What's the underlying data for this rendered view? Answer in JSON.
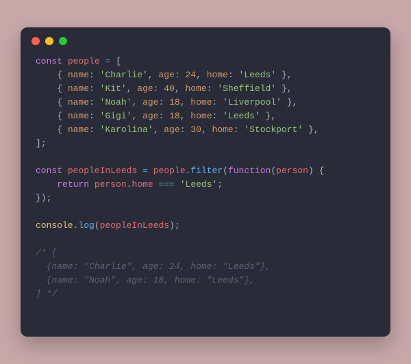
{
  "colors": {
    "pageBg": "#c8a7a8",
    "windowBg": "#292c38",
    "text": "#abb2bf",
    "keyword": "#c678dd",
    "identifier": "#e06c75",
    "function": "#61afef",
    "punctuation": "#abb2bf",
    "property": "#d19a66",
    "string": "#98c379",
    "number": "#d19a66",
    "operator": "#56b6c2",
    "builtin": "#e5c07b",
    "comment": "#5c6370",
    "dotRed": "#ff5f56",
    "dotYellow": "#ffbd2e",
    "dotGreen": "#27c93f"
  },
  "lines": [
    {
      "i": 0,
      "tokens": [
        {
          "t": "const",
          "c": "kw"
        },
        {
          "t": " "
        },
        {
          "t": "people",
          "c": "id"
        },
        {
          "t": " "
        },
        {
          "t": "=",
          "c": "op"
        },
        {
          "t": " ["
        }
      ]
    },
    {
      "i": 1,
      "tokens": [
        {
          "t": "    { "
        },
        {
          "t": "name",
          "c": "pr"
        },
        {
          "t": ": "
        },
        {
          "t": "'Charlie'",
          "c": "st"
        },
        {
          "t": ", "
        },
        {
          "t": "age",
          "c": "pr"
        },
        {
          "t": ": "
        },
        {
          "t": "24",
          "c": "nm"
        },
        {
          "t": ", "
        },
        {
          "t": "home",
          "c": "pr"
        },
        {
          "t": ": "
        },
        {
          "t": "'Leeds'",
          "c": "st"
        },
        {
          "t": " },"
        }
      ]
    },
    {
      "i": 2,
      "tokens": [
        {
          "t": "    { "
        },
        {
          "t": "name",
          "c": "pr"
        },
        {
          "t": ": "
        },
        {
          "t": "'Kit'",
          "c": "st"
        },
        {
          "t": ", "
        },
        {
          "t": "age",
          "c": "pr"
        },
        {
          "t": ": "
        },
        {
          "t": "40",
          "c": "nm"
        },
        {
          "t": ", "
        },
        {
          "t": "home",
          "c": "pr"
        },
        {
          "t": ": "
        },
        {
          "t": "'Sheffield'",
          "c": "st"
        },
        {
          "t": " },"
        }
      ]
    },
    {
      "i": 3,
      "tokens": [
        {
          "t": "    { "
        },
        {
          "t": "name",
          "c": "pr"
        },
        {
          "t": ": "
        },
        {
          "t": "'Noah'",
          "c": "st"
        },
        {
          "t": ", "
        },
        {
          "t": "age",
          "c": "pr"
        },
        {
          "t": ": "
        },
        {
          "t": "18",
          "c": "nm"
        },
        {
          "t": ", "
        },
        {
          "t": "home",
          "c": "pr"
        },
        {
          "t": ": "
        },
        {
          "t": "'Liverpool'",
          "c": "st"
        },
        {
          "t": " },"
        }
      ]
    },
    {
      "i": 4,
      "tokens": [
        {
          "t": "    { "
        },
        {
          "t": "name",
          "c": "pr"
        },
        {
          "t": ": "
        },
        {
          "t": "'Gigi'",
          "c": "st"
        },
        {
          "t": ", "
        },
        {
          "t": "age",
          "c": "pr"
        },
        {
          "t": ": "
        },
        {
          "t": "18",
          "c": "nm"
        },
        {
          "t": ", "
        },
        {
          "t": "home",
          "c": "pr"
        },
        {
          "t": ": "
        },
        {
          "t": "'Leeds'",
          "c": "st"
        },
        {
          "t": " },"
        }
      ]
    },
    {
      "i": 5,
      "tokens": [
        {
          "t": "    { "
        },
        {
          "t": "name",
          "c": "pr"
        },
        {
          "t": ": "
        },
        {
          "t": "'Karolina'",
          "c": "st"
        },
        {
          "t": ", "
        },
        {
          "t": "age",
          "c": "pr"
        },
        {
          "t": ": "
        },
        {
          "t": "30",
          "c": "nm"
        },
        {
          "t": ", "
        },
        {
          "t": "home",
          "c": "pr"
        },
        {
          "t": ": "
        },
        {
          "t": "'Stockport'",
          "c": "st"
        },
        {
          "t": " },"
        }
      ]
    },
    {
      "i": 6,
      "tokens": [
        {
          "t": "];"
        }
      ]
    },
    {
      "i": 7,
      "tokens": [
        {
          "t": ""
        }
      ]
    },
    {
      "i": 8,
      "tokens": [
        {
          "t": "const",
          "c": "kw"
        },
        {
          "t": " "
        },
        {
          "t": "peopleInLeeds",
          "c": "id"
        },
        {
          "t": " "
        },
        {
          "t": "=",
          "c": "op"
        },
        {
          "t": " "
        },
        {
          "t": "people",
          "c": "id"
        },
        {
          "t": "."
        },
        {
          "t": "filter",
          "c": "fn"
        },
        {
          "t": "("
        },
        {
          "t": "function",
          "c": "kw"
        },
        {
          "t": "("
        },
        {
          "t": "person",
          "c": "id"
        },
        {
          "t": ") {"
        }
      ]
    },
    {
      "i": 9,
      "tokens": [
        {
          "t": "    "
        },
        {
          "t": "return",
          "c": "kw"
        },
        {
          "t": " "
        },
        {
          "t": "person",
          "c": "id"
        },
        {
          "t": "."
        },
        {
          "t": "home",
          "c": "id"
        },
        {
          "t": " "
        },
        {
          "t": "===",
          "c": "op"
        },
        {
          "t": " "
        },
        {
          "t": "'Leeds'",
          "c": "st"
        },
        {
          "t": ";"
        }
      ]
    },
    {
      "i": 10,
      "tokens": [
        {
          "t": "});"
        }
      ]
    },
    {
      "i": 11,
      "tokens": [
        {
          "t": ""
        }
      ]
    },
    {
      "i": 12,
      "tokens": [
        {
          "t": "console",
          "c": "bi"
        },
        {
          "t": "."
        },
        {
          "t": "log",
          "c": "fn"
        },
        {
          "t": "("
        },
        {
          "t": "peopleInLeeds",
          "c": "id"
        },
        {
          "t": ");"
        }
      ]
    },
    {
      "i": 13,
      "tokens": [
        {
          "t": ""
        }
      ]
    },
    {
      "i": 14,
      "tokens": [
        {
          "t": "/* [",
          "c": "cm"
        }
      ]
    },
    {
      "i": 15,
      "tokens": [
        {
          "t": "  {name: \"Charlie\", age: 24, home: \"Leeds\"},",
          "c": "cm"
        }
      ]
    },
    {
      "i": 16,
      "tokens": [
        {
          "t": "  {name: \"Noah\", age: 18, home: \"Leeds\"},",
          "c": "cm"
        }
      ]
    },
    {
      "i": 17,
      "tokens": [
        {
          "t": "] */",
          "c": "cm"
        }
      ]
    }
  ]
}
